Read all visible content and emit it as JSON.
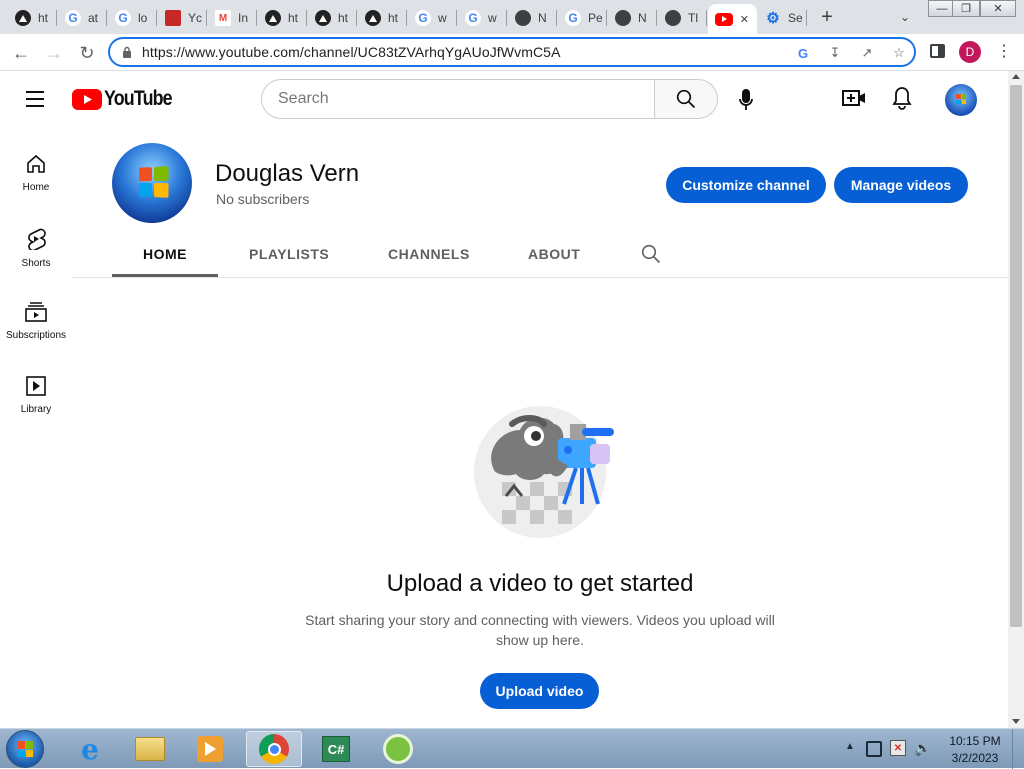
{
  "browser": {
    "tabs": [
      {
        "title": "ht",
        "icon": "vercel-icon",
        "color": "#222222"
      },
      {
        "title": "at",
        "icon": "google-icon",
        "color": "#ffffff"
      },
      {
        "title": "lo",
        "icon": "google-icon",
        "color": "#ffffff"
      },
      {
        "title": "Yc",
        "icon": "book-icon",
        "color": "#ffffff"
      },
      {
        "title": "In",
        "icon": "gmail-icon",
        "color": "#ffffff"
      },
      {
        "title": "ht",
        "icon": "vercel-icon",
        "color": "#222222"
      },
      {
        "title": "ht",
        "icon": "vercel-icon",
        "color": "#222222"
      },
      {
        "title": "ht",
        "icon": "vercel-icon",
        "color": "#222222"
      },
      {
        "title": "w",
        "icon": "google-icon",
        "color": "#ffffff"
      },
      {
        "title": "w",
        "icon": "google-icon",
        "color": "#ffffff"
      },
      {
        "title": "N",
        "icon": "github-icon",
        "color": "#ffffff"
      },
      {
        "title": "Pe",
        "icon": "google-icon",
        "color": "#ffffff"
      },
      {
        "title": "N",
        "icon": "github-icon",
        "color": "#ffffff"
      },
      {
        "title": "Tl",
        "icon": "github-icon",
        "color": "#ffffff"
      },
      {
        "title": "",
        "icon": "youtube-icon",
        "color": "#ff0000"
      },
      {
        "title": "Se",
        "icon": "settings-gear-icon",
        "color": "#1a73e8"
      }
    ],
    "url": "https://www.youtube.com/channel/UC83tZVArhqYgAUoJfWvmC5A",
    "profile_initial": "D"
  },
  "youtube": {
    "logo_text": "YouTube",
    "search_placeholder": "Search",
    "sidebar": [
      {
        "label": "Home",
        "icon": "home-icon"
      },
      {
        "label": "Shorts",
        "icon": "shorts-icon"
      },
      {
        "label": "Subscriptions",
        "icon": "subscriptions-icon"
      },
      {
        "label": "Library",
        "icon": "library-icon"
      }
    ],
    "channel": {
      "name": "Douglas Vern",
      "subscribers": "No subscribers",
      "customize_label": "Customize channel",
      "manage_label": "Manage videos"
    },
    "tabs": [
      "HOME",
      "PLAYLISTS",
      "CHANNELS",
      "ABOUT"
    ],
    "empty_state": {
      "title": "Upload a video to get started",
      "desc_line1": "Start sharing your story and connecting with viewers. Videos you upload will",
      "desc_line2": "show up here.",
      "upload_label": "Upload video"
    }
  },
  "taskbar": {
    "time": "10:15 PM",
    "date": "3/2/2023"
  },
  "colors": {
    "accent": "#065fd4",
    "youtube_red": "#ff0000",
    "chrome_focus": "#1a73e8",
    "profile": "#c2185b"
  }
}
